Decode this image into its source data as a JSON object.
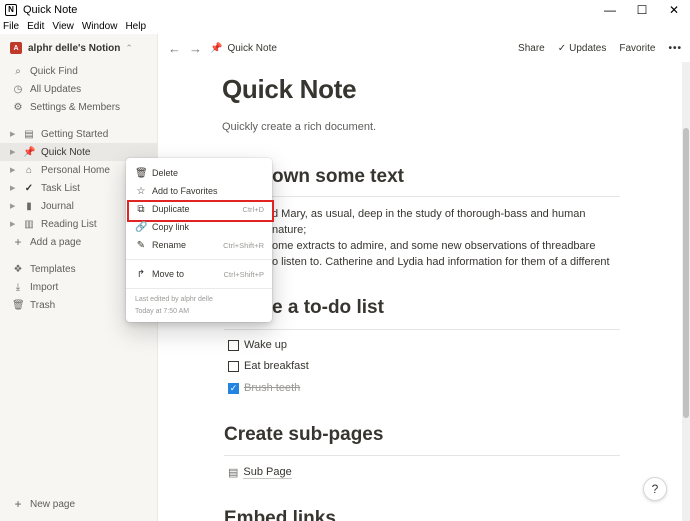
{
  "window": {
    "title": "Quick Note",
    "app_icon": "N",
    "controls": [
      "—",
      "☐",
      "✕"
    ]
  },
  "menubar": [
    "File",
    "Edit",
    "View",
    "Window",
    "Help"
  ],
  "sidebar": {
    "workspace": "alphr delle's Notion",
    "workspace_avatar": "A",
    "top_items": [
      {
        "label": "Quick Find",
        "icon": "search-icon"
      },
      {
        "label": "All Updates",
        "icon": "clock-icon"
      },
      {
        "label": "Settings & Members",
        "icon": "gear-icon"
      }
    ],
    "pages": [
      {
        "label": "Getting Started",
        "icon": "document-icon"
      },
      {
        "label": "Quick Note",
        "icon": "pushpin-icon"
      },
      {
        "label": "Personal Home",
        "icon": "house-icon"
      },
      {
        "label": "Task List",
        "icon": "checkmark-icon"
      },
      {
        "label": "Journal",
        "icon": "book-icon"
      },
      {
        "label": "Reading List",
        "icon": "books-icon"
      }
    ],
    "add_page": "Add a page",
    "bottom_items": [
      {
        "label": "Templates",
        "icon": "templates-icon"
      },
      {
        "label": "Import",
        "icon": "import-icon"
      },
      {
        "label": "Trash",
        "icon": "trash-icon"
      }
    ],
    "new_page": "New page"
  },
  "topbar": {
    "breadcrumb": "Quick Note",
    "share": "Share",
    "updates": "Updates",
    "favorite": "Favorite",
    "more": "•••"
  },
  "page": {
    "title": "Quick Note",
    "description": "Quickly create a rich document.",
    "heading1": "own some text",
    "paragraph": [
      "d Mary, as usual, deep in the study of thorough-bass and human nature;",
      "ome extracts to admire, and some new observations of threadbare",
      "o listen to. Catherine and Lydia had information for them of a different"
    ],
    "heading2": "e a to-do list",
    "todos": [
      {
        "label": "Wake up",
        "checked": false
      },
      {
        "label": "Eat breakfast",
        "checked": false
      },
      {
        "label": "Brush teeth",
        "checked": true
      }
    ],
    "heading3": "Create sub-pages",
    "subpage": "Sub Page",
    "heading4": "Embed links"
  },
  "context_menu": {
    "items": [
      {
        "label": "Delete",
        "icon": "trash-icon",
        "shortcut": ""
      },
      {
        "label": "Add to Favorites",
        "icon": "star-icon",
        "shortcut": ""
      },
      {
        "label": "Duplicate",
        "icon": "duplicate-icon",
        "shortcut": "Ctrl+D"
      },
      {
        "label": "Copy link",
        "icon": "link-icon",
        "shortcut": ""
      },
      {
        "label": "Rename",
        "icon": "rename-icon",
        "shortcut": "Ctrl+Shift+R"
      }
    ],
    "move_to": {
      "label": "Move to",
      "icon": "move-icon",
      "shortcut": "Ctrl+Shift+P"
    },
    "last_edited_by": "Last edited by alphr delle",
    "last_edited_time": "Today at 7:50 AM"
  },
  "help_button": "?",
  "colors": {
    "sidebar_bg": "#f7f6f3",
    "highlight_border": "#e02424",
    "checkbox_blue": "#2383e2",
    "pin_red": "#e03e3e"
  }
}
